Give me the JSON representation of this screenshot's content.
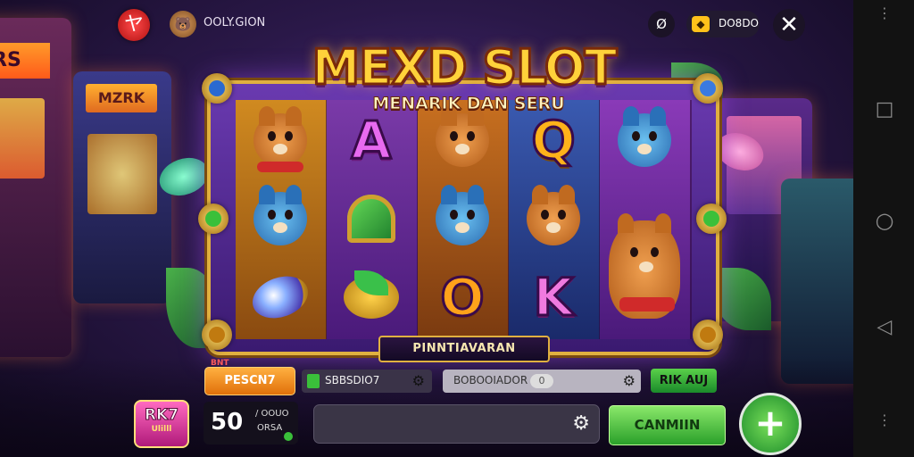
{
  "topbar": {
    "logo_glyph": "ヤ",
    "avatar_glyph": "🐻",
    "username": "OOLY.GION",
    "icon_glyph": "Ø",
    "coin_glyph": "◆",
    "coins": "DO8DO",
    "close_glyph": "✕"
  },
  "title": {
    "main": "MEXD SLOT",
    "sub": "MENARIK DAN SERU"
  },
  "background": {
    "arcade_marquee_left": "ERS",
    "arcade_marquee_left2": "MZRK"
  },
  "reels": {
    "letters": {
      "a": "A",
      "q": "Q",
      "o": "O",
      "k": "K"
    }
  },
  "payline_label": "PINNTIAVARAN",
  "controls": {
    "tag": "BNT",
    "orange_button": "PESCN7",
    "field1_text": "SBBSDIO7",
    "field2_text": "BOBOOIADOR",
    "field2_toggle": "0",
    "green_small_button": "RIK AUJ",
    "bonus_label": "RK7",
    "bonus_sub": "Ulilll",
    "bet_value": "50",
    "bet_unit1": "/ OOUO",
    "bet_unit2": "ORSA",
    "spin_button": "CANMIIN",
    "plus_glyph": "+",
    "gear_glyph": "⚙"
  },
  "navbar": {
    "menu": "⋮",
    "square": "□",
    "circle": "○",
    "back": "◁",
    "menu2": "⋮"
  },
  "colors": {
    "accent_gold": "#e0b040",
    "spin_green": "#2aa02a",
    "orange": "#e0700a",
    "frame_purple": "#6a3ab0"
  }
}
